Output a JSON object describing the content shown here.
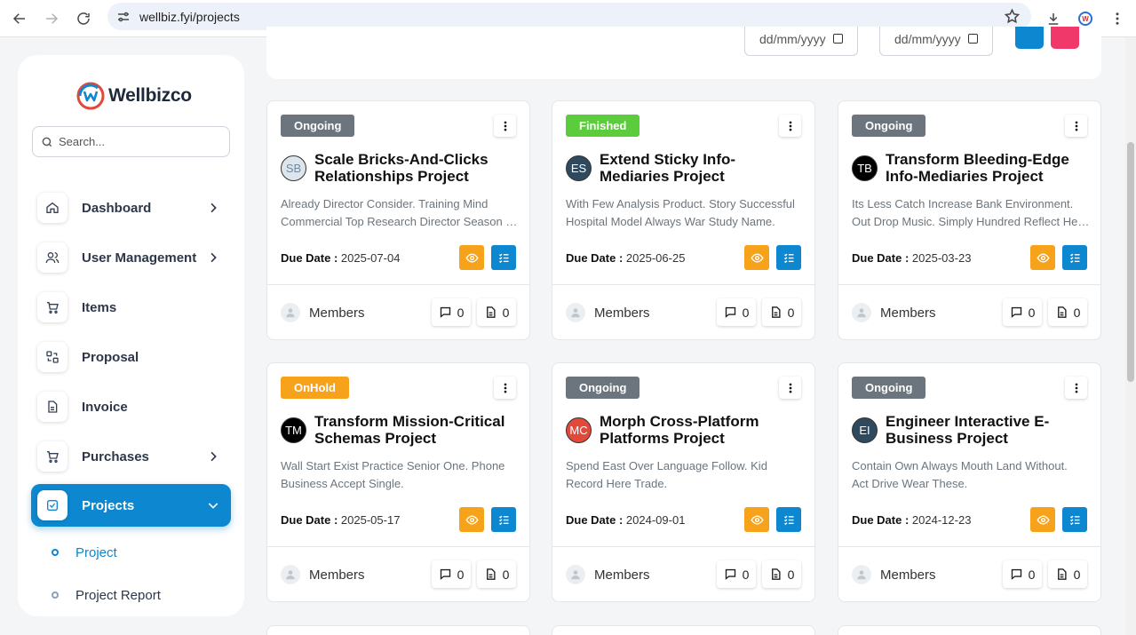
{
  "browser": {
    "url": "wellbiz.fyi/projects"
  },
  "brand": {
    "name": "Wellbizco",
    "accent": "#0d87cf"
  },
  "sidebar": {
    "search_placeholder": "Search...",
    "items": [
      {
        "label": "Dashboard",
        "icon": "home-icon",
        "has_chevron": true
      },
      {
        "label": "User Management",
        "icon": "users-icon",
        "has_chevron": true
      },
      {
        "label": "Items",
        "icon": "cart-icon",
        "has_chevron": false
      },
      {
        "label": "Proposal",
        "icon": "exchange-icon",
        "has_chevron": false
      },
      {
        "label": "Invoice",
        "icon": "file-icon",
        "has_chevron": false
      },
      {
        "label": "Purchases",
        "icon": "cart-icon",
        "has_chevron": true
      },
      {
        "label": "Projects",
        "icon": "checkbox-icon",
        "has_chevron": true,
        "active": true
      }
    ],
    "sub_items": [
      {
        "label": "Project",
        "active": true
      },
      {
        "label": "Project Report",
        "active": false
      }
    ]
  },
  "filters": {
    "date_from_placeholder": "dd/mm/yyyy",
    "date_to_placeholder": "dd/mm/yyyy"
  },
  "projects": [
    {
      "status": "Ongoing",
      "status_color": "#6c757d",
      "initials": "SB",
      "avatar_bg": "#dde6ee",
      "avatar_fg": "#6c8aa3",
      "title": "Scale Bricks-And-Clicks Relationships Project",
      "desc1": "Already Director Consider. Training Mind",
      "desc2": "Commercial Top Research Director Season Some.",
      "due_label": "Due Date :",
      "due_date": "2025-07-04",
      "members_label": "Members",
      "comments": "0",
      "files": "0"
    },
    {
      "status": "Finished",
      "status_color": "#5bcc3b",
      "initials": "ES",
      "avatar_bg": "#2f4a5e",
      "avatar_fg": "#ffffff",
      "title": "Extend Sticky Info-Mediaries Project",
      "desc1": "With Few Analysis Product. Story Successful",
      "desc2": "Hospital Model Always War Study Name.",
      "due_label": "Due Date :",
      "due_date": "2025-06-25",
      "members_label": "Members",
      "comments": "0",
      "files": "0"
    },
    {
      "status": "Ongoing",
      "status_color": "#6c757d",
      "initials": "TB",
      "avatar_bg": "#000000",
      "avatar_fg": "#ffffff",
      "title": "Transform Bleeding-Edge Info-Mediaries Project",
      "desc1": "Its Less Catch Increase Bank Environment.",
      "desc2": "Out Drop Music. Simply Hundred Reflect Heart.",
      "due_label": "Due Date :",
      "due_date": "2025-03-23",
      "members_label": "Members",
      "comments": "0",
      "files": "0"
    },
    {
      "status": "OnHold",
      "status_color": "#f7a21b",
      "initials": "TM",
      "avatar_bg": "#000000",
      "avatar_fg": "#ffffff",
      "title": "Transform Mission-Critical Schemas Project",
      "desc1": "Wall Start Exist Practice Senior One. Phone",
      "desc2": "Business Accept Single.",
      "due_label": "Due Date :",
      "due_date": "2025-05-17",
      "members_label": "Members",
      "comments": "0",
      "files": "0"
    },
    {
      "status": "Ongoing",
      "status_color": "#6c757d",
      "initials": "MC",
      "avatar_bg": "#e2493a",
      "avatar_fg": "#ffffff",
      "title": "Morph Cross-Platform Platforms Project",
      "desc1": "Spend East Over Language Follow. Kid",
      "desc2": "Record Here Trade.",
      "due_label": "Due Date :",
      "due_date": "2024-09-01",
      "members_label": "Members",
      "comments": "0",
      "files": "0"
    },
    {
      "status": "Ongoing",
      "status_color": "#6c757d",
      "initials": "EI",
      "avatar_bg": "#2f4a5e",
      "avatar_fg": "#ffffff",
      "title": "Engineer Interactive E-Business Project",
      "desc1": "Contain Own Always Mouth Land Without.",
      "desc2": "Act Drive Wear These.",
      "due_label": "Due Date :",
      "due_date": "2024-12-23",
      "members_label": "Members",
      "comments": "0",
      "files": "0"
    }
  ]
}
